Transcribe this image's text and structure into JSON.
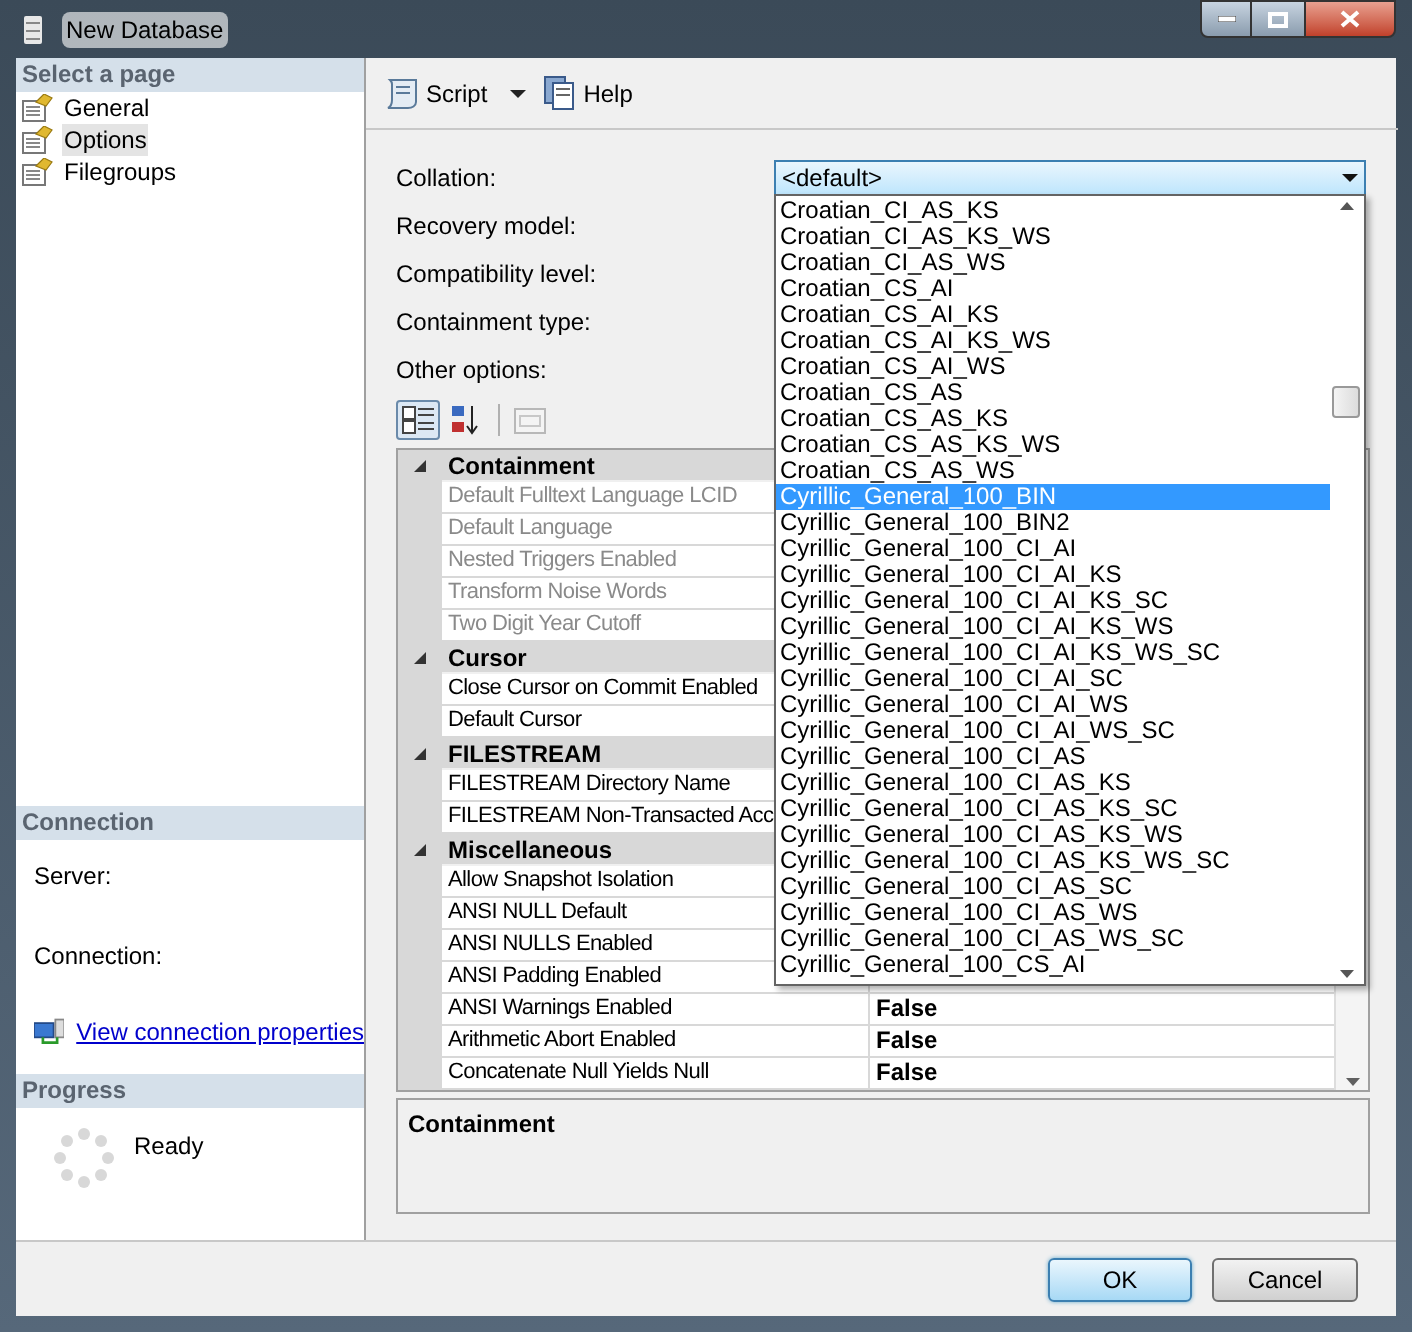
{
  "window": {
    "title": "New Database"
  },
  "sidebar": {
    "header": "Select a page",
    "pages": [
      {
        "label": "General",
        "selected": false
      },
      {
        "label": "Options",
        "selected": true
      },
      {
        "label": "Filegroups",
        "selected": false
      }
    ]
  },
  "connection": {
    "header": "Connection",
    "fields": [
      "Server:",
      "Connection:"
    ],
    "link": "View connection properties"
  },
  "progress": {
    "header": "Progress",
    "status": "Ready"
  },
  "toolbar": {
    "items": [
      {
        "label": "Script",
        "kind": "split"
      },
      {
        "label": "Help",
        "kind": "help"
      }
    ]
  },
  "options": {
    "labels": [
      "Collation:",
      "Recovery model:",
      "Compatibility level:",
      "Containment type:",
      "Other options:"
    ],
    "collation": {
      "value": "<default>",
      "expanded": true,
      "items": [
        {
          "label": "Croatian_CI_AS_KS",
          "selected": false
        },
        {
          "label": "Croatian_CI_AS_KS_WS",
          "selected": false
        },
        {
          "label": "Croatian_CI_AS_WS",
          "selected": false
        },
        {
          "label": "Croatian_CS_AI",
          "selected": false
        },
        {
          "label": "Croatian_CS_AI_KS",
          "selected": false
        },
        {
          "label": "Croatian_CS_AI_KS_WS",
          "selected": false
        },
        {
          "label": "Croatian_CS_AI_WS",
          "selected": false
        },
        {
          "label": "Croatian_CS_AS",
          "selected": false
        },
        {
          "label": "Croatian_CS_AS_KS",
          "selected": false
        },
        {
          "label": "Croatian_CS_AS_KS_WS",
          "selected": false
        },
        {
          "label": "Croatian_CS_AS_WS",
          "selected": false
        },
        {
          "label": "Cyrillic_General_100_BIN",
          "selected": true
        },
        {
          "label": "Cyrillic_General_100_BIN2",
          "selected": false
        },
        {
          "label": "Cyrillic_General_100_CI_AI",
          "selected": false
        },
        {
          "label": "Cyrillic_General_100_CI_AI_KS",
          "selected": false
        },
        {
          "label": "Cyrillic_General_100_CI_AI_KS_SC",
          "selected": false
        },
        {
          "label": "Cyrillic_General_100_CI_AI_KS_WS",
          "selected": false
        },
        {
          "label": "Cyrillic_General_100_CI_AI_KS_WS_SC",
          "selected": false
        },
        {
          "label": "Cyrillic_General_100_CI_AI_SC",
          "selected": false
        },
        {
          "label": "Cyrillic_General_100_CI_AI_WS",
          "selected": false
        },
        {
          "label": "Cyrillic_General_100_CI_AI_WS_SC",
          "selected": false
        },
        {
          "label": "Cyrillic_General_100_CI_AS",
          "selected": false
        },
        {
          "label": "Cyrillic_General_100_CI_AS_KS",
          "selected": false
        },
        {
          "label": "Cyrillic_General_100_CI_AS_KS_SC",
          "selected": false
        },
        {
          "label": "Cyrillic_General_100_CI_AS_KS_WS",
          "selected": false
        },
        {
          "label": "Cyrillic_General_100_CI_AS_KS_WS_SC",
          "selected": false
        },
        {
          "label": "Cyrillic_General_100_CI_AS_SC",
          "selected": false
        },
        {
          "label": "Cyrillic_General_100_CI_AS_WS",
          "selected": false
        },
        {
          "label": "Cyrillic_General_100_CI_AS_WS_SC",
          "selected": false
        },
        {
          "label": "Cyrillic_General_100_CS_AI",
          "selected": false
        }
      ]
    },
    "sort_buttons": [
      {
        "kind": "categorized",
        "selected": true
      },
      {
        "kind": "alphabetical",
        "selected": false
      }
    ]
  },
  "property_grid": {
    "sections": [
      {
        "title": "Containment",
        "expanded": true,
        "rows": [
          {
            "name": "Default Fulltext Language LCID",
            "disabled": true
          },
          {
            "name": "Default Language",
            "disabled": true
          },
          {
            "name": "Nested Triggers Enabled",
            "disabled": true
          },
          {
            "name": "Transform Noise Words",
            "disabled": true
          },
          {
            "name": "Two Digit Year Cutoff",
            "disabled": true
          }
        ]
      },
      {
        "title": "Cursor",
        "expanded": true,
        "rows": [
          {
            "name": "Close Cursor on Commit Enabled",
            "disabled": false
          },
          {
            "name": "Default Cursor",
            "disabled": false
          }
        ]
      },
      {
        "title": "FILESTREAM",
        "expanded": true,
        "rows": [
          {
            "name": "FILESTREAM Directory Name",
            "disabled": false
          },
          {
            "name": "FILESTREAM Non-Transacted Acc",
            "disabled": false
          }
        ]
      },
      {
        "title": "Miscellaneous",
        "expanded": true,
        "rows": [
          {
            "name": "Allow Snapshot Isolation",
            "disabled": false
          },
          {
            "name": "ANSI NULL Default",
            "disabled": false
          },
          {
            "name": "ANSI NULLS Enabled",
            "disabled": false
          },
          {
            "name": "ANSI Padding Enabled",
            "disabled": false
          },
          {
            "name": "ANSI Warnings Enabled",
            "disabled": false,
            "value": "False"
          },
          {
            "name": "Arithmetic Abort Enabled",
            "disabled": false,
            "value": "False"
          },
          {
            "name": "Concatenate Null Yields Null",
            "disabled": false,
            "value": "False"
          }
        ]
      }
    ],
    "description": {
      "title": "Containment"
    }
  },
  "buttons": [
    {
      "label": "OK",
      "default": true
    },
    {
      "label": "Cancel",
      "default": false
    }
  ]
}
